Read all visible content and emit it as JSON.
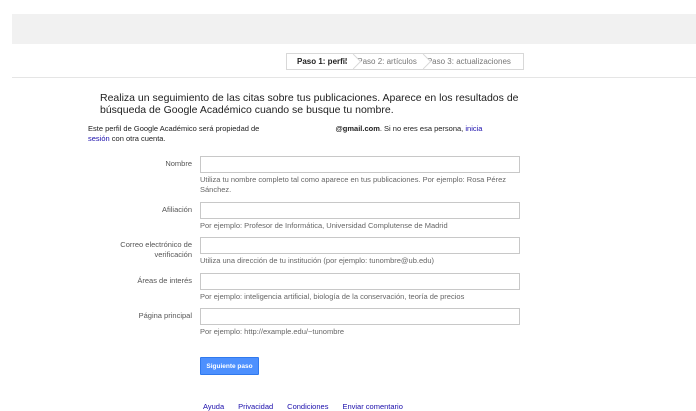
{
  "steps": {
    "step1": "Paso 1: perfil",
    "step2": "Paso 2: artículos",
    "step3": "Paso 3: actualizaciones"
  },
  "intro": "Realiza un seguimiento de las citas sobre tus publicaciones. Aparece en los resultados de búsqueda de Google Académico cuando se busque tu nombre.",
  "owner": {
    "prefix": "Este perfil de Google Académico será propiedad de",
    "email": "@gmail.com",
    "middle": ". Si no eres esa persona,",
    "link1": "inicia",
    "link2": "sesión",
    "suffix": "con otra cuenta."
  },
  "form": {
    "name": {
      "label": "Nombre",
      "value": "",
      "help": "Utiliza tu nombre completo tal como aparece en tus publicaciones. Por ejemplo: Rosa Pérez Sánchez."
    },
    "affiliation": {
      "label": "Afiliación",
      "value": "",
      "help": "Por ejemplo: Profesor de Informática, Universidad Complutense de Madrid"
    },
    "email": {
      "label": "Correo electrónico de verificación",
      "value": "",
      "help": "Utiliza una dirección de tu institución (por ejemplo: tunombre@ub.edu)"
    },
    "interests": {
      "label": "Áreas de interés",
      "value": "",
      "help": "Por ejemplo: inteligencia artificial, biología de la conservación, teoría de precios"
    },
    "homepage": {
      "label": "Página principal",
      "value": "",
      "help": "Por ejemplo: http://example.edu/~tunombre"
    }
  },
  "next_button": "Siguiente paso",
  "footer": {
    "help": "Ayuda",
    "privacy": "Privacidad",
    "terms": "Condiciones",
    "feedback": "Enviar comentario"
  },
  "colors": {
    "accent": "#4d90fe",
    "link": "#1a0dab"
  }
}
